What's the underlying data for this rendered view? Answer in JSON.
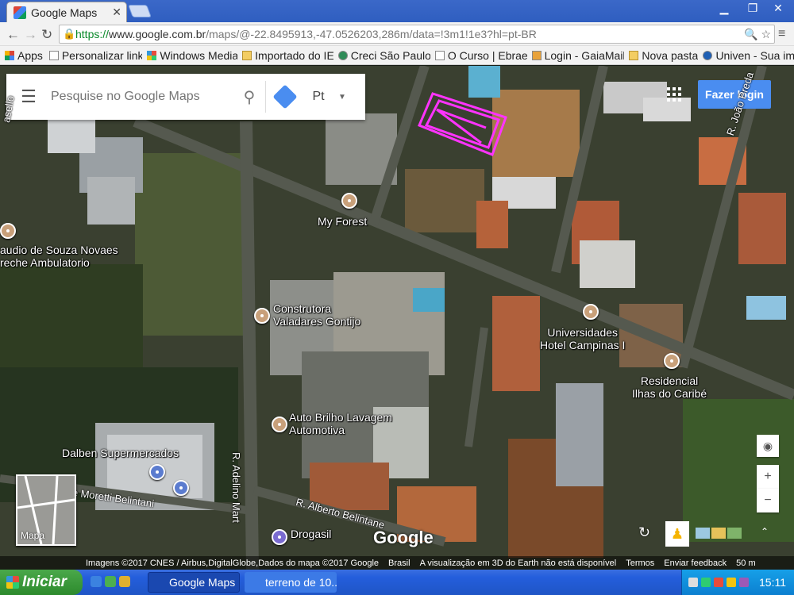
{
  "browser": {
    "tab_title": "Google Maps",
    "url_prefix": "https://",
    "url_host": "www.google.com.br",
    "url_path": "/maps/@-22.8495913,-47.0526203,286m/data=!3m1!1e3?hl=pt-BR"
  },
  "bookmarks": [
    "Apps",
    "Personalizar link",
    "Windows Media",
    "Importado do IE",
    "Creci São Paulo",
    "O Curso | Ebrae",
    "Login - GaiaMail",
    "Nova pasta",
    "Univen - Sua im"
  ],
  "map": {
    "search_placeholder": "Pesquise no Google Maps",
    "language": "Pt",
    "login_label": "Fazer login",
    "imagery_label": "Mapa",
    "google_logo": "Google",
    "places": [
      {
        "name": "My Forest"
      },
      {
        "name": "audio de Souza Novaes\nreche Ambulatorio"
      },
      {
        "name": "Construtora\nValadares Gontijo"
      },
      {
        "name": "Universidades\nHotel Campinas I"
      },
      {
        "name": "Residencial\nIlhas do Caribé"
      },
      {
        "name": "Auto Brilho Lavagem\nAutomotiva"
      },
      {
        "name": "Dalben Supermercados"
      },
      {
        "name": "Drogasil"
      }
    ],
    "streets": {
      "joao_preda": "R. João Preda",
      "adelino": "R. Adelino Mart",
      "alberto": "R. Alberto Belintane",
      "moretti": "e Moretti Belintani",
      "small": "asello"
    },
    "footer": {
      "imagery": "Imagens ©2017 CNES / Airbus,DigitalGlobe,Dados do mapa ©2017 Google",
      "country": "Brasil",
      "notice": "A visualização em 3D do Earth não está disponível",
      "terms": "Termos",
      "feedback": "Enviar feedback",
      "scale": "50 m"
    }
  },
  "taskbar": {
    "start": "Iniciar",
    "tasks": [
      "Google Maps ...",
      "terreno de 10..."
    ],
    "clock": "15:11"
  }
}
